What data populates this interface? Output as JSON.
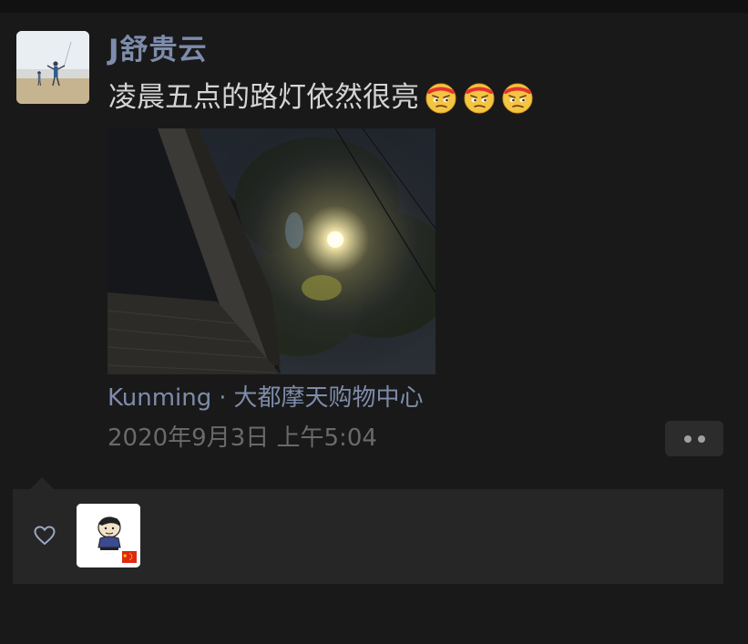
{
  "post": {
    "author": "J舒贵云",
    "text": "凌晨五点的路灯依然很亮",
    "emojis": [
      "smirk-face-icon",
      "smirk-face-icon",
      "smirk-face-icon"
    ],
    "location": {
      "city": "Kunming",
      "separator": "·",
      "place": "大都摩天购物中心"
    },
    "timestamp": "2020年9月3日 上午5:04"
  },
  "likes": {
    "icon": "heart-outline-icon",
    "users": [
      {
        "avatar": "cartoon-avatar-with-flag"
      }
    ]
  },
  "colors": {
    "background": "#191919",
    "name": "#7e8cab",
    "text": "#d4d4d4",
    "meta": "#6a6a6a",
    "panel": "#262626"
  }
}
